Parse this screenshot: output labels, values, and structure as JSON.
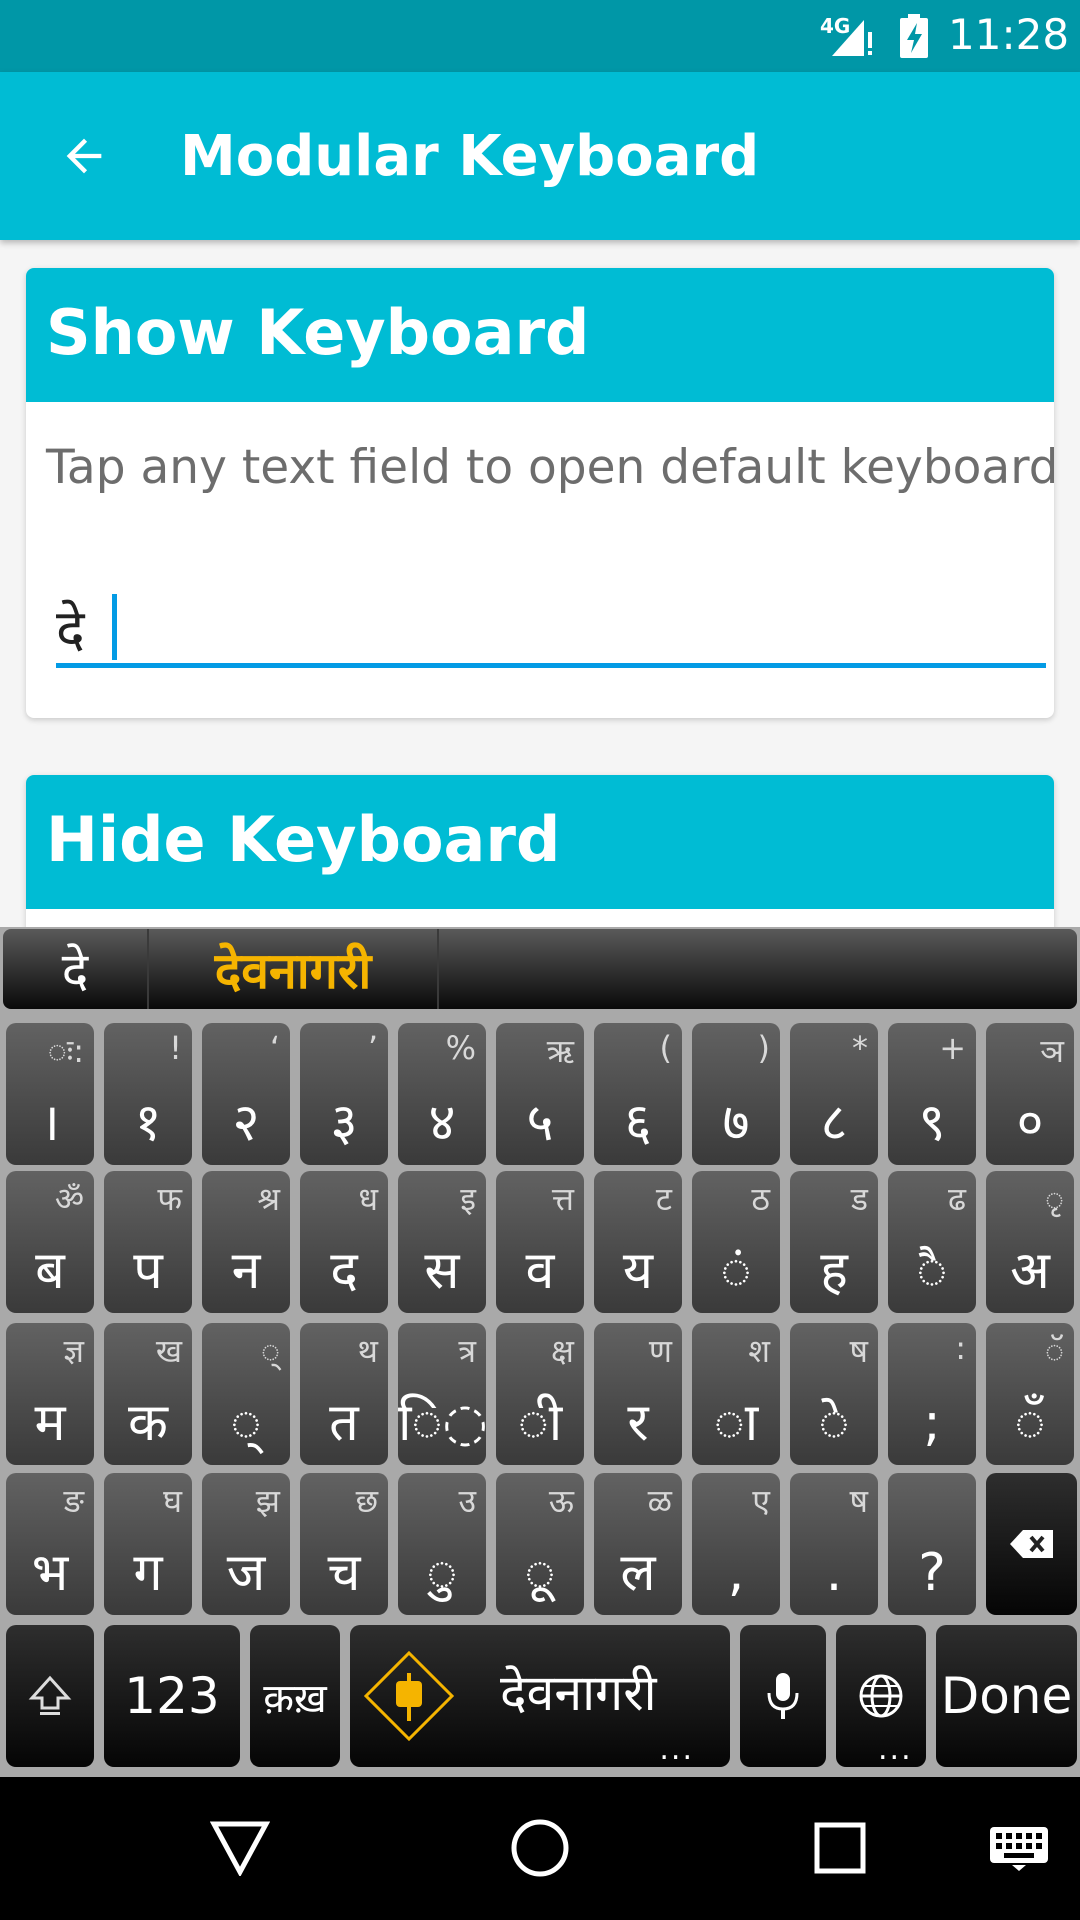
{
  "status_bar": {
    "network": "4G",
    "time": "11:28"
  },
  "app_bar": {
    "title": "Modular Keyboard",
    "back_icon": "arrow-left-icon"
  },
  "card_show": {
    "title": "Show Keyboard",
    "description": "Tap any text field to open default keyboard",
    "field_value": "दे"
  },
  "card_hide": {
    "title": "Hide Keyboard"
  },
  "keyboard": {
    "suggestions": [
      "दे",
      "देवनागरी"
    ],
    "row1": [
      {
        "main": "।",
        "alt": "ः:"
      },
      {
        "main": "१",
        "alt": "!"
      },
      {
        "main": "२",
        "alt": "‘"
      },
      {
        "main": "३",
        "alt": "’"
      },
      {
        "main": "४",
        "alt": "%"
      },
      {
        "main": "५",
        "alt": "ऋ"
      },
      {
        "main": "६",
        "alt": "("
      },
      {
        "main": "७",
        "alt": ")"
      },
      {
        "main": "८",
        "alt": "*"
      },
      {
        "main": "९",
        "alt": "+"
      },
      {
        "main": "०",
        "alt": "ञ"
      }
    ],
    "row2": [
      {
        "main": "ब",
        "alt": "ॐ"
      },
      {
        "main": "प",
        "alt": "फ"
      },
      {
        "main": "न",
        "alt": "श्र"
      },
      {
        "main": "द",
        "alt": "ध"
      },
      {
        "main": "स",
        "alt": "इ"
      },
      {
        "main": "व",
        "alt": "त्त"
      },
      {
        "main": "य",
        "alt": "ट"
      },
      {
        "main": "◌ं",
        "alt": "ठ"
      },
      {
        "main": "ह",
        "alt": "ड"
      },
      {
        "main": "◌ै",
        "alt": "ढ"
      },
      {
        "main": "अ",
        "alt": "◌ृ"
      }
    ],
    "row3": [
      {
        "main": "म",
        "alt": "ज्ञ"
      },
      {
        "main": "क",
        "alt": "ख"
      },
      {
        "main": "◌्",
        "alt": "◌्"
      },
      {
        "main": "त",
        "alt": "थ"
      },
      {
        "main": "ि◌",
        "alt": "त्र"
      },
      {
        "main": "◌ी",
        "alt": "क्ष"
      },
      {
        "main": "र",
        "alt": "ण"
      },
      {
        "main": "◌ा",
        "alt": "श"
      },
      {
        "main": "◌े",
        "alt": "ष"
      },
      {
        "main": ";",
        "alt": ":"
      },
      {
        "main": "◌ँ",
        "alt": "◌ॅ"
      }
    ],
    "row4": [
      {
        "main": "भ",
        "alt": "ङ"
      },
      {
        "main": "ग",
        "alt": "घ"
      },
      {
        "main": "ज",
        "alt": "झ"
      },
      {
        "main": "च",
        "alt": "छ"
      },
      {
        "main": "◌ु",
        "alt": "उ"
      },
      {
        "main": "◌ू",
        "alt": "ऊ"
      },
      {
        "main": "ल",
        "alt": "ळ"
      },
      {
        "main": ",",
        "alt": "ए"
      },
      {
        "main": ".",
        "alt": "ष"
      },
      {
        "main": "?",
        "alt": ""
      }
    ],
    "bottom": {
      "numbers_label": "123",
      "nukta_label": "क़ख़",
      "space_label": "देवनागरी",
      "space_dots": "...",
      "globe_dots": "...",
      "done_label": "Done"
    }
  },
  "nav_bar": {
    "back": "triangle-back-icon",
    "home": "circle-home-icon",
    "recents": "square-recents-icon",
    "keyboard": "keyboard-switch-icon"
  }
}
